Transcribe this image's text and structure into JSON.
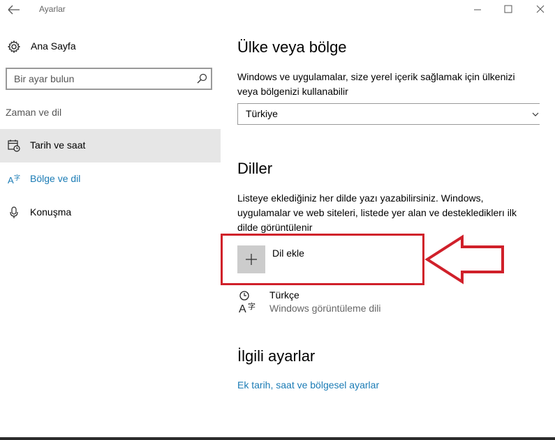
{
  "window": {
    "title": "Ayarlar"
  },
  "sidebar": {
    "home_label": "Ana Sayfa",
    "search_placeholder": "Bir ayar bulun",
    "section_label": "Zaman ve dil",
    "items": [
      {
        "label": "Tarih ve saat",
        "icon": "calendar-clock-icon",
        "selected": true
      },
      {
        "label": "Bölge ve dil",
        "icon": "language-icon",
        "active": true
      },
      {
        "label": "Konuşma",
        "icon": "microphone-icon"
      }
    ]
  },
  "main": {
    "region": {
      "heading": "Ülke veya bölge",
      "description": "Windows ve uygulamalar, size yerel içerik sağlamak için ülkenizi veya bölgenizi kullanabilir",
      "selected_country": "Türkiye"
    },
    "languages": {
      "heading": "Diller",
      "description": "Listeye eklediğiniz her dilde yazı yazabilirsiniz. Windows, uygulamalar ve web siteleri, listede yer alan ve desteklediklerı ilk dilde görüntülenir",
      "add_label": "Dil ekle",
      "items": [
        {
          "name": "Türkçe",
          "subtitle": "Windows görüntüleme dili"
        }
      ]
    },
    "related": {
      "heading": "İlgili ayarlar",
      "link": "Ek tarih, saat ve bölgesel ayarlar"
    }
  },
  "colors": {
    "accent": "#1a7bb5",
    "annotation": "#d0202a",
    "selected_bg": "#e6e6e6"
  }
}
